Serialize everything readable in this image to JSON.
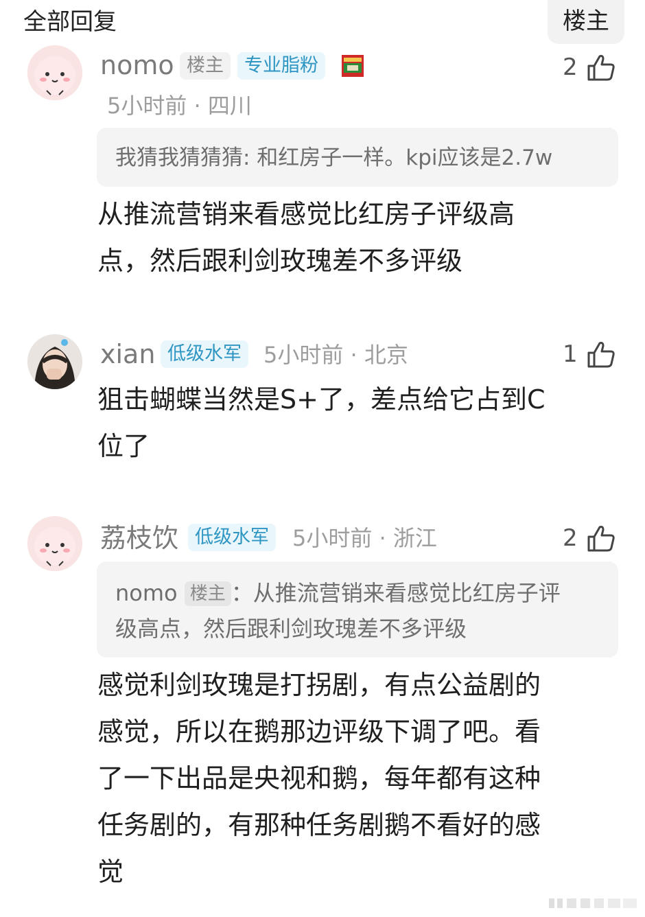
{
  "header": {
    "title": "全部回复",
    "owner_button": "楼主"
  },
  "comments": [
    {
      "username": "nomo",
      "owner_tag": "楼主",
      "level_tag": "专业脂粉",
      "meta": "5小时前 · 四川",
      "likes": "2",
      "quote": "我猜我猜猜猜: 和红房子一样。kpi应该是2.7w",
      "text_lines": [
        "从推流营销来看感觉比红房子评级高",
        "点，然后跟利剑玫瑰差不多评级"
      ]
    },
    {
      "username": "xian",
      "level_tag": "低级水军",
      "meta": "5小时前 · 北京",
      "likes": "1",
      "text_lines": [
        "狙击蝴蝶当然是S+了，差点给它占到C",
        "位了"
      ]
    },
    {
      "username": "荔枝饮",
      "level_tag": "低级水军",
      "meta": "5小时前 · 浙江",
      "likes": "2",
      "quote_user": "nomo",
      "quote_owner_tag": "楼主",
      "quote_lines": [
        "：从推流营销来看感觉比红房子评",
        "级高点，然后跟利剑玫瑰差不多评级"
      ],
      "text_lines": [
        "感觉利剑玫瑰是打拐剧，有点公益剧的",
        "感觉，所以在鹅那边评级下调了吧。看",
        "了一下出品是央视和鹅，每年都有这种",
        "任务剧的，有那种任务剧鹅不看好的感",
        "觉"
      ]
    }
  ],
  "colors": {
    "level_tag_text": "#2f96c3",
    "level_tag_bg": "#e9f6fb",
    "quote_bg": "#f4f4f4",
    "meta_text": "#9d9d9d"
  },
  "icons": [
    "thumbs-up-icon",
    "fan-badge-icon",
    "avatar-peach-icon",
    "avatar-photo-icon"
  ]
}
